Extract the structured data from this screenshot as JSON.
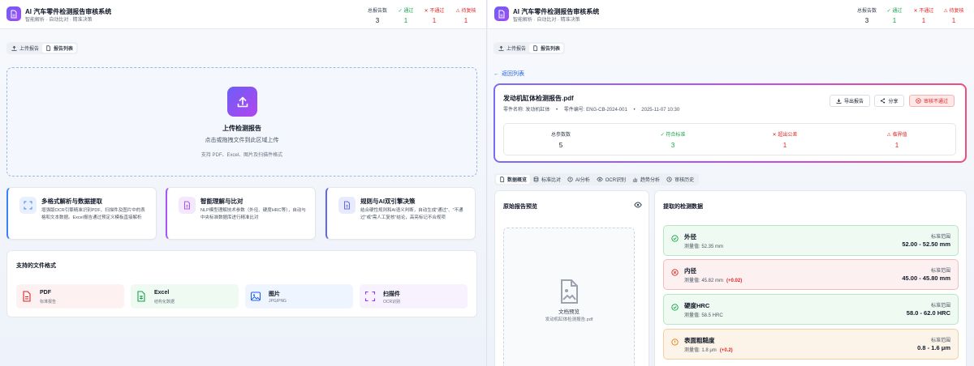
{
  "app": {
    "title": "AI 汽车零件检测报告审核系统",
    "subtitle": "智能解析 · 自动比对 · 精准决策"
  },
  "header_stats": [
    {
      "label": "总报告数",
      "value": "3",
      "color": "#374151"
    },
    {
      "label": "✓ 通过",
      "value": "1",
      "color": "#16a34a"
    },
    {
      "label": "✕ 不通过",
      "value": "1",
      "color": "#dc2626"
    },
    {
      "label": "⚠ 待复核",
      "value": "1",
      "color": "#dc2626"
    }
  ],
  "nav_tabs": [
    {
      "label": "上传报告",
      "icon": "upload-icon"
    },
    {
      "label": "报告列表",
      "icon": "document-icon"
    }
  ],
  "upload": {
    "title": "上传检测报告",
    "hint": "点击或拖拽文件到此区域上传",
    "supported": "支持 PDF、Excel、图片及扫描件格式"
  },
  "features": [
    {
      "title": "多格式解析与数据提取",
      "desc": "增强版OCR引擎精准识别PDF、扫描件及图片中的表格和文本数据。Excel报告通过预定义模板直接解析",
      "accent": "#3b82f6",
      "icon": "scan-icon"
    },
    {
      "title": "智能理解与比对",
      "desc": "NLP模型理解技术参数（外径、硬度HRC等），自动与中央标准数据库进行精准比对",
      "accent": "#a855f7",
      "icon": "document-icon"
    },
    {
      "title": "规则与AI双引擎决策",
      "desc": "结合硬性规则和AI语义判断，自动生成\"通过\"、\"不通过\"或\"需人工复核\"结论，高亮标记不合规项",
      "accent": "#6366f1",
      "icon": "document-icon"
    }
  ],
  "formats": {
    "title": "支持的文件格式",
    "items": [
      {
        "name": "PDF",
        "desc": "标准报告",
        "bg": "#fdf1f1",
        "color": "#dc2626",
        "icon": "pdf-file-icon"
      },
      {
        "name": "Excel",
        "desc": "结构化数据",
        "bg": "#effaf2",
        "color": "#16a34a",
        "icon": "spreadsheet-icon"
      },
      {
        "name": "图片",
        "desc": "JPG/PNG",
        "bg": "#eff5fe",
        "color": "#2563eb",
        "icon": "image-icon"
      },
      {
        "name": "扫描件",
        "desc": "OCR识别",
        "bg": "#f7f2fe",
        "color": "#9333ea",
        "icon": "scan-icon"
      }
    ]
  },
  "detail": {
    "back_label": "返回列表",
    "file_name": "发动机缸体检测报告.pdf",
    "part_name_label": "零件名称: 发动机缸体",
    "part_no_label": "零件编号: ENG-CB-2024-001",
    "date": "2025-11-07 10:30",
    "sep": "•",
    "buttons": {
      "export": "导出报告",
      "share": "分享",
      "verdict": "审核不通过"
    },
    "stats": [
      {
        "label": "总参数数",
        "value": "5",
        "color": "#374151"
      },
      {
        "label": "✓ 符合标准",
        "value": "3",
        "color": "#16a34a"
      },
      {
        "label": "✕ 超出公差",
        "value": "1",
        "color": "#dc2626"
      },
      {
        "label": "⚠ 临界值",
        "value": "1",
        "color": "#dc2626"
      }
    ],
    "tabs": [
      {
        "label": "数据概览",
        "icon": "overview-icon"
      },
      {
        "label": "标准比对",
        "icon": "database-icon"
      },
      {
        "label": "AI分析",
        "icon": "ai-icon"
      },
      {
        "label": "OCR识别",
        "icon": "eye-icon"
      },
      {
        "label": "趋势分析",
        "icon": "chart-icon"
      },
      {
        "label": "审核历史",
        "icon": "history-icon"
      }
    ],
    "preview": {
      "title": "原始报告预览",
      "doc_label": "文档预览",
      "file_name": "发动机缸体检测报告.pdf"
    },
    "extracted": {
      "title": "提取的检测数据",
      "range_label": "标准范围",
      "items": [
        {
          "name": "外径",
          "measured": "测量值: 52.35 mm",
          "deviation": "",
          "range": "52.00 - 52.50 mm",
          "status": "pass"
        },
        {
          "name": "内径",
          "measured": "测量值: 45.82 mm",
          "deviation": "(+0.02)",
          "range": "45.00 - 45.80 mm",
          "status": "fail"
        },
        {
          "name": "硬度HRC",
          "measured": "测量值: 58.5 HRC",
          "deviation": "",
          "range": "58.0 - 62.0 HRC",
          "status": "pass"
        },
        {
          "name": "表面粗糙度",
          "measured": "测量值: 1.8 μm",
          "deviation": "(+0.2)",
          "range": "0.8 - 1.6 μm",
          "status": "warn"
        }
      ]
    }
  }
}
